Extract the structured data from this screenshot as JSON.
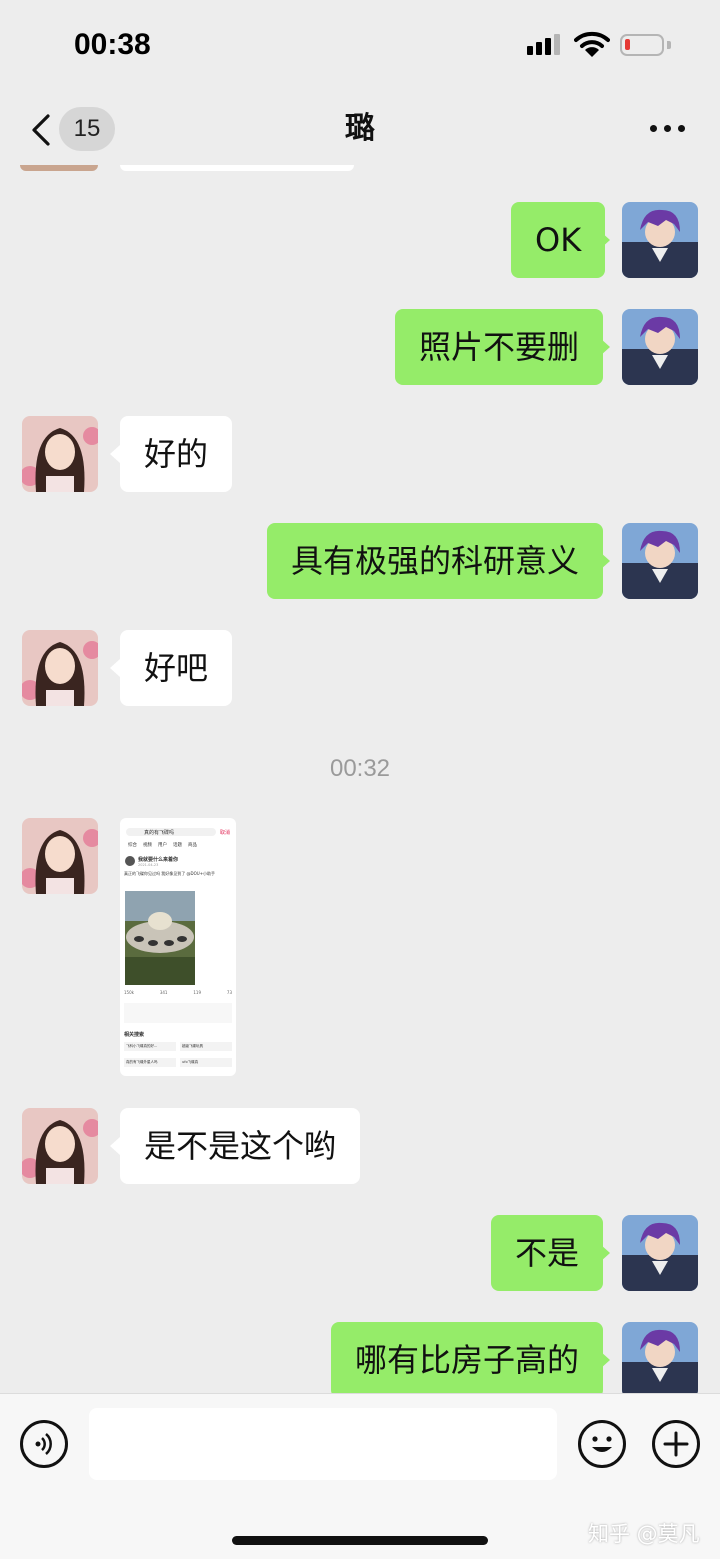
{
  "status_bar": {
    "time": "00:38",
    "battery_level": 0.15
  },
  "nav": {
    "unread_count": "15",
    "title": "璐"
  },
  "messages": [
    {
      "side": "right",
      "text": "OK"
    },
    {
      "side": "right",
      "text": "照片不要删"
    },
    {
      "side": "left",
      "text": "好的"
    },
    {
      "side": "right",
      "text": "具有极强的科研意义"
    },
    {
      "side": "left",
      "text": "好吧"
    },
    {
      "side": "left",
      "text": "是不是这个哟"
    },
    {
      "side": "right",
      "text": "不是"
    },
    {
      "side": "right",
      "text": "哪有比房子高的"
    }
  ],
  "timestamp": "00:32",
  "shared_image": {
    "search_text": "真的有飞碟吗",
    "cancel": "取消",
    "tabs": [
      "综合",
      "视频",
      "用户",
      "话题",
      "商品"
    ],
    "author": "我就要什么来着你",
    "date": "2021-04-23",
    "caption": "真正的飞碟你见过吗 我好像见到了 @DOU+小助手",
    "stats": [
      "150k",
      "341",
      "119",
      "73"
    ],
    "related_title": "相关搜索",
    "related": [
      "飞科小飞碟真的好...",
      "超级飞碟玩具",
      "真的有飞碟外星人吗",
      "ufo飞碟真"
    ]
  },
  "watermark": "知乎 @莫凡",
  "colors": {
    "outgoing_bubble": "#95ec69",
    "incoming_bubble": "#ffffff",
    "background": "#ededed"
  }
}
